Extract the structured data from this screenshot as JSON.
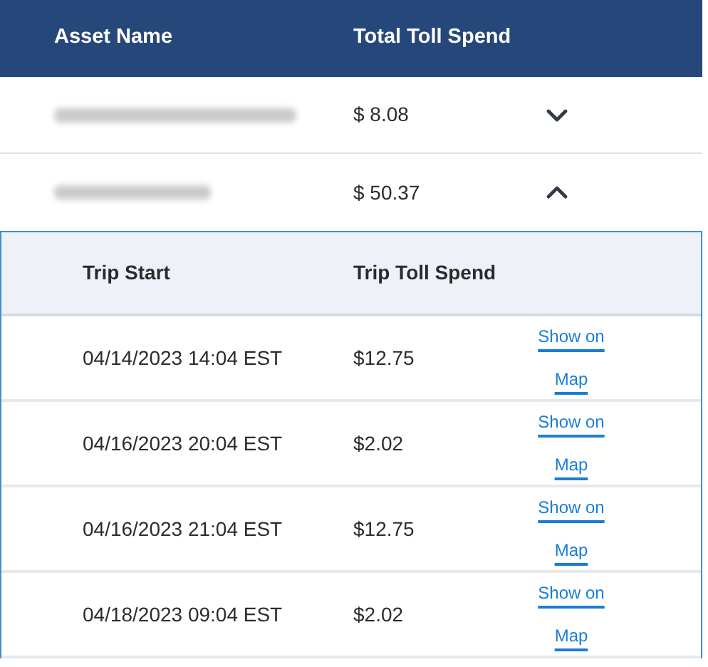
{
  "table": {
    "columns": [
      "Asset Name",
      "Total Toll Spend"
    ],
    "assets": [
      {
        "total": "$ 8.08",
        "expanded": false
      },
      {
        "total": "$ 50.37",
        "expanded": true,
        "trips_table": {
          "columns": [
            "Trip Start",
            "Trip Toll Spend"
          ],
          "trips": [
            {
              "start": "04/14/2023 14:04 EST",
              "spend": "$12.75",
              "link": "Show on Map"
            },
            {
              "start": "04/16/2023 20:04 EST",
              "spend": "$2.02",
              "link": "Show on Map"
            },
            {
              "start": "04/16/2023 21:04 EST",
              "spend": "$12.75",
              "link": "Show on Map"
            },
            {
              "start": "04/18/2023 09:04 EST",
              "spend": "$2.02",
              "link": "Show on Map"
            }
          ]
        }
      }
    ]
  }
}
